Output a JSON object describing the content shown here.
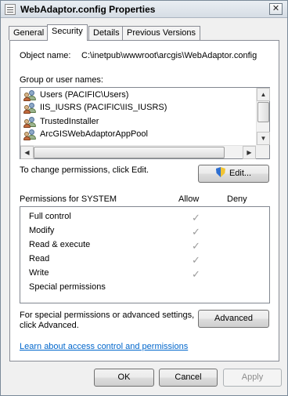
{
  "window": {
    "title": "WebAdaptor.config Properties",
    "close_glyph": "✕"
  },
  "tabs": [
    {
      "label": "General"
    },
    {
      "label": "Security"
    },
    {
      "label": "Details"
    },
    {
      "label": "Previous Versions"
    }
  ],
  "object": {
    "label": "Object name:",
    "value": "C:\\inetpub\\wwwroot\\arcgis\\WebAdaptor.config"
  },
  "groups": {
    "label": "Group or user names:",
    "items": [
      {
        "label": "Users (PACIFIC\\Users)",
        "icon": "users-group-icon"
      },
      {
        "label": "IIS_IUSRS (PACIFIC\\IIS_IUSRS)",
        "icon": "users-group-icon"
      },
      {
        "label": "TrustedInstaller",
        "icon": "users-group-icon"
      },
      {
        "label": "ArcGISWebAdaptorAppPool",
        "icon": "users-group-icon"
      }
    ]
  },
  "scroll": {
    "up": "▲",
    "down": "▼",
    "left": "◀",
    "right": "▶"
  },
  "edit": {
    "hint": "To change permissions, click Edit.",
    "button": "Edit..."
  },
  "permissions": {
    "header": "Permissions for SYSTEM",
    "allow": "Allow",
    "deny": "Deny",
    "check_glyph": "✓",
    "rows": [
      {
        "name": "Full control",
        "allow": true
      },
      {
        "name": "Modify",
        "allow": true
      },
      {
        "name": "Read & execute",
        "allow": true
      },
      {
        "name": "Read",
        "allow": true
      },
      {
        "name": "Write",
        "allow": true
      },
      {
        "name": "Special permissions",
        "allow": false
      }
    ]
  },
  "advanced": {
    "hint_line1": "For special permissions or advanced settings,",
    "hint_line2": "click Advanced.",
    "button": "Advanced"
  },
  "learn_link": "Learn about access control and permissions",
  "footer": {
    "ok": "OK",
    "cancel": "Cancel",
    "apply": "Apply"
  }
}
